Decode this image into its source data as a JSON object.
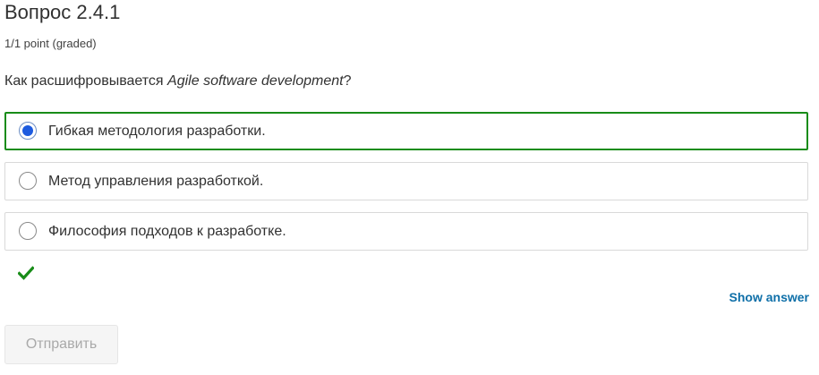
{
  "problem": {
    "title": "Вопрос 2.4.1",
    "points": "1/1 point (graded)",
    "question_prefix": "Как расшифровывается ",
    "question_italic": "Agile software development",
    "question_suffix": "?"
  },
  "choices": [
    {
      "label": "Гибкая методология разработки.",
      "selected": true,
      "correct": true
    },
    {
      "label": "Метод управления разработкой.",
      "selected": false,
      "correct": false
    },
    {
      "label": "Философия подходов к разработке.",
      "selected": false,
      "correct": false
    }
  ],
  "status": {
    "icon": "checkmark-icon",
    "color": "#188c18"
  },
  "actions": {
    "show_answer_label": "Show answer",
    "submit_label": "Отправить",
    "submit_disabled": true
  },
  "colors": {
    "correct_border": "#188c18",
    "radio_selected": "#1d5bdf",
    "link": "#0e6fa8"
  }
}
